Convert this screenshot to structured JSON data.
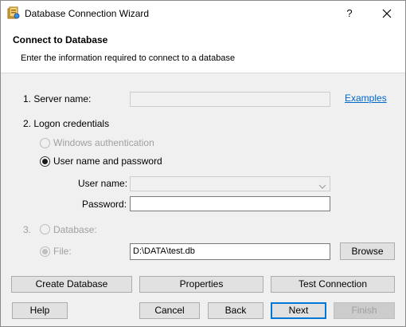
{
  "window": {
    "title": "Database Connection Wizard",
    "help_glyph": "?",
    "close_glyph": "✕"
  },
  "header": {
    "title": "Connect to Database",
    "subtitle": "Enter the information required to connect to a database"
  },
  "server": {
    "label": "1. Server name:",
    "value": "",
    "examples_link": "Examples"
  },
  "logon": {
    "label": "2. Logon credentials",
    "windows_auth": "Windows authentication",
    "user_password": "User name and password",
    "user_name_label": "User name:",
    "user_name_value": "",
    "password_label": "Password:",
    "password_value": ""
  },
  "step3": {
    "number": "3.",
    "database_label": "Database:",
    "file_label": "File:",
    "file_value": "D:\\DATA\\test.db",
    "browse": "Browse"
  },
  "actions": {
    "create_database": "Create Database",
    "properties": "Properties",
    "test_connection": "Test Connection"
  },
  "footer": {
    "help": "Help",
    "cancel": "Cancel",
    "back": "Back",
    "next": "Next",
    "finish": "Finish"
  },
  "colors": {
    "link": "#0066cc",
    "default_button_border": "#0078d7",
    "disabled_text": "#a0a0a0"
  }
}
